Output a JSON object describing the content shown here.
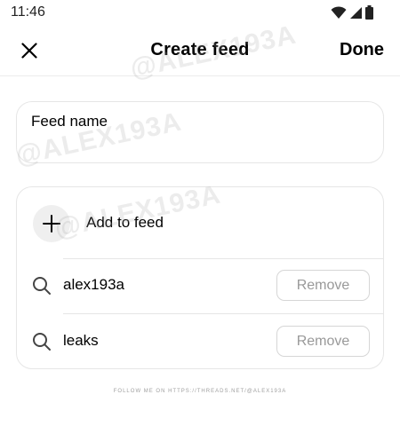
{
  "status_bar": {
    "time": "11:46",
    "icons": [
      "wifi-icon",
      "signal-icon",
      "battery-icon"
    ]
  },
  "header": {
    "close_icon": "close-icon",
    "title": "Create feed",
    "done_label": "Done"
  },
  "feed_name": {
    "placeholder": "Feed name",
    "value": ""
  },
  "add_to_feed": {
    "icon": "plus-icon",
    "label": "Add to feed"
  },
  "profiles": [
    {
      "name": "alex193a",
      "icon": "search-icon",
      "action": "Remove"
    },
    {
      "name": "leaks",
      "icon": "search-icon",
      "action": "Remove"
    }
  ],
  "footer": {
    "text": "FOLLOW ME ON HTTPS://THREADS.NET/@ALEX193A"
  },
  "watermark": {
    "text": "@ALEX193A"
  },
  "colors": {
    "background": "#ffffff",
    "border": "#e6e6e6",
    "remove_text": "#999999",
    "text": "#000000"
  }
}
